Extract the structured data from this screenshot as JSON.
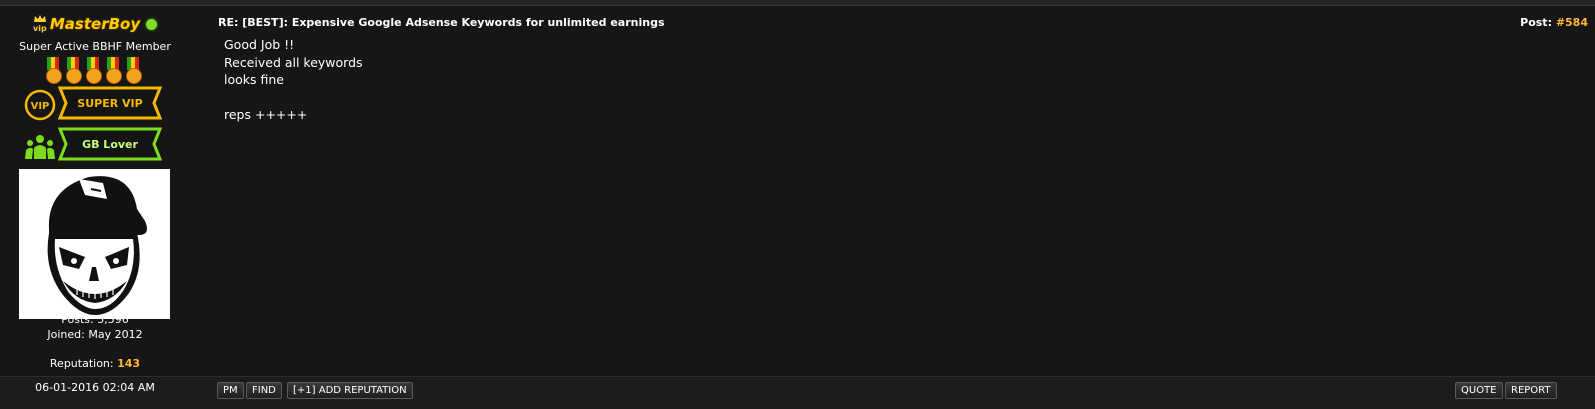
{
  "user": {
    "name": "MasterBoy",
    "vip_mark": "vip",
    "title": "Super Active BBHF Member",
    "awards": [
      {
        "label": "SUPER VIP",
        "icon": "vip-icon",
        "badge": "VIP",
        "color": "#f5b800"
      },
      {
        "label": "GB Lover",
        "icon": "people-icon",
        "color": "#7ddc1e"
      }
    ],
    "posts_label": "Posts: 5,596",
    "joined_label": "Joined: May 2012",
    "reputation_label": "Reputation:",
    "reputation_value": "143",
    "status_color": "#7fdc2b"
  },
  "post": {
    "subject": "RE: [BEST]: Expensive Google Adsense Keywords for unlimited earnings",
    "number_label": "Post:",
    "number": "#584",
    "lines": [
      "Good Job !!",
      "Received all keywords",
      "looks fine",
      "",
      "reps +++++"
    ]
  },
  "footer": {
    "date": "06-01-2016 02:04 AM",
    "buttons": {
      "pm": "PM",
      "find": "FIND",
      "rep": "[+1] ADD REPUTATION",
      "quote": "QUOTE",
      "report": "REPORT"
    }
  },
  "colors": {
    "accent": "#ffb833",
    "username": "#ffcc00",
    "background": "#161616"
  }
}
